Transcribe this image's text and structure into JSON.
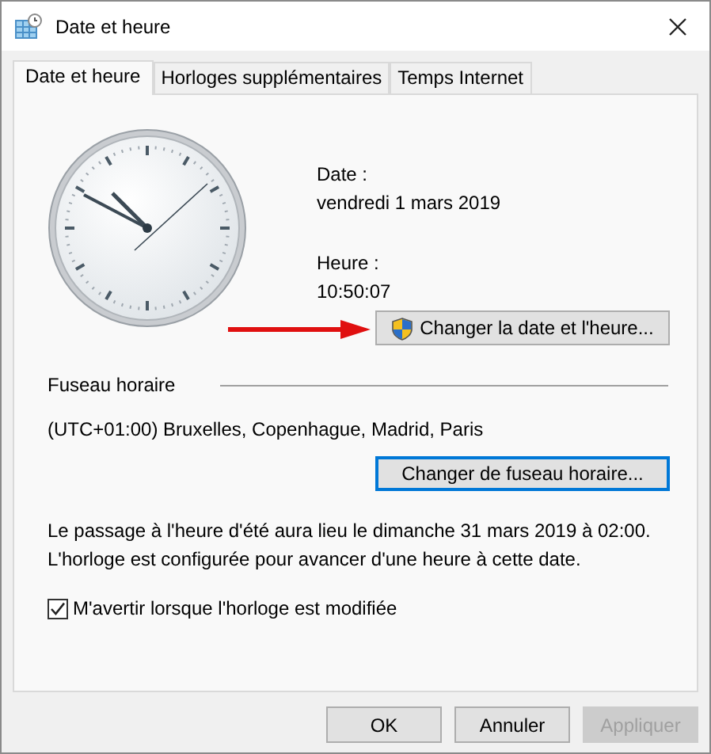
{
  "window": {
    "title": "Date et heure"
  },
  "tabs": [
    {
      "label": "Date et heure",
      "selected": true
    },
    {
      "label": "Horloges supplémentaires",
      "selected": false
    },
    {
      "label": "Temps Internet",
      "selected": false
    }
  ],
  "date": {
    "label": "Date :",
    "value": "vendredi 1 mars 2019"
  },
  "time": {
    "label": "Heure :",
    "value": "10:50:07"
  },
  "change_datetime_button": {
    "label": "Changer la date et l'heure...",
    "focused": false
  },
  "timezone": {
    "heading": "Fuseau horaire",
    "value": "(UTC+01:00) Bruxelles, Copenhague, Madrid, Paris",
    "button": {
      "label": "Changer de fuseau horaire...",
      "focused": true
    }
  },
  "dst_notice": [
    "Le passage à l'heure d'été aura lieu le dimanche 31 mars 2019 à 02:00.",
    "L'horloge est configurée pour avancer d'une heure à cette date."
  ],
  "notify_checkbox": {
    "label": "M'avertir lorsque l'horloge est modifiée",
    "checked": true
  },
  "buttons": [
    {
      "label": "OK",
      "disabled": false
    },
    {
      "label": "Annuler",
      "disabled": false
    },
    {
      "label": "Appliquer",
      "disabled": true
    }
  ]
}
